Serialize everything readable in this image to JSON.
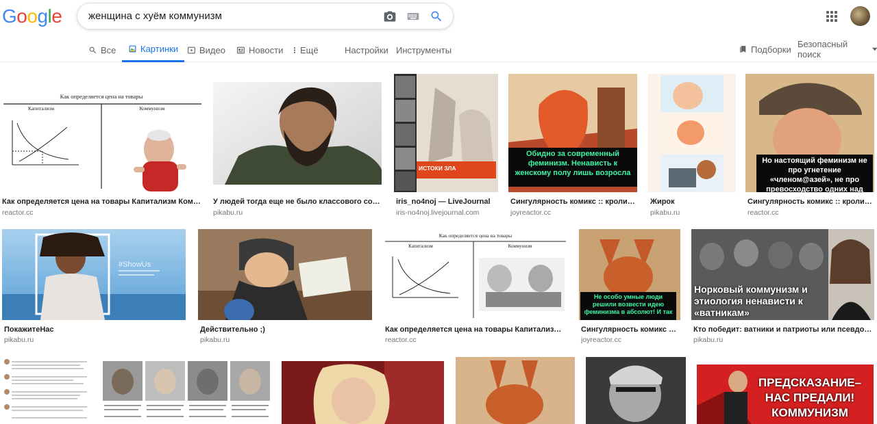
{
  "header": {
    "logo_letters": [
      {
        "ch": "G",
        "color": "#4285F4"
      },
      {
        "ch": "o",
        "color": "#EA4335"
      },
      {
        "ch": "o",
        "color": "#FBBC05"
      },
      {
        "ch": "g",
        "color": "#4285F4"
      },
      {
        "ch": "l",
        "color": "#34A853"
      },
      {
        "ch": "e",
        "color": "#EA4335"
      }
    ],
    "query": "женщина с хуём коммунизм",
    "camera_icon": "camera-icon",
    "keyboard_icon": "keyboard-icon",
    "search_icon": "search-icon",
    "apps_icon": "apps-grid-icon"
  },
  "tabs": {
    "all": "Все",
    "images": "Картинки",
    "video": "Видео",
    "news": "Новости",
    "more": "Ещё",
    "settings": "Настройки",
    "tools": "Инструменты",
    "collections": "Подборки",
    "safesearch": "Безопасный поиск"
  },
  "results": {
    "row1": [
      {
        "title": "Как определяется цена на товары Капитализм Коммунизм ...",
        "source": "reactor.cc",
        "caption": "Как определяется цена на товары",
        "left_label": "Капитализм",
        "right_label": "Коммунизм"
      },
      {
        "title": "У людей тогда еще не было классового созна...",
        "source": "pikabu.ru"
      },
      {
        "title": "iris_no4noj — LiveJournal",
        "source": "iris-no4noj.livejournal.com",
        "caption": "ИСТОКИ ЗЛА"
      },
      {
        "title": "Сингулярность комикс :: кролик ::...",
        "source": "joyreactor.cc",
        "caption": "Обидно за современный феминизм. Ненависть к женскому полу лишь возросла"
      },
      {
        "title": "Жирок",
        "source": "pikabu.ru"
      },
      {
        "title": "Сингулярность комикс :: кролик :: ...",
        "source": "reactor.cc",
        "caption": "Но настоящий феминизм не про угнетение «членом@азей», не про превосходство одних над другими"
      }
    ],
    "row2": [
      {
        "title": "ПокажитеНас",
        "source": "pikabu.ru",
        "caption": "#ShowUs"
      },
      {
        "title": "Действительно ;)",
        "source": "pikabu.ru"
      },
      {
        "title": "Как определяется цена на товары Капитализм Ко...",
        "source": "reactor.cc",
        "caption": "Как определяется цена на товары",
        "left_label": "Капитализм",
        "right_label": "Коммунизм"
      },
      {
        "title": "Сингулярность комикс :: к...",
        "source": "joyreactor.cc",
        "caption": "Не особо умные люди решили возвести идею феминизма в абсолют! И так"
      },
      {
        "title": "Кто победит: ватники и патриоты или псевдо-ком...",
        "source": "pikabu.ru",
        "caption": "Норковый коммунизм и этиология ненависти к «ватникам»"
      }
    ],
    "row3": [
      {
        "title": ""
      },
      {
        "title": ""
      },
      {
        "title": ""
      },
      {
        "title": ""
      },
      {
        "title": ""
      },
      {
        "title": "",
        "caption": "ПРЕДСКАЗАНИЕ– НАС ПРЕДАЛИ! КОММУНИЗМ"
      }
    ]
  }
}
